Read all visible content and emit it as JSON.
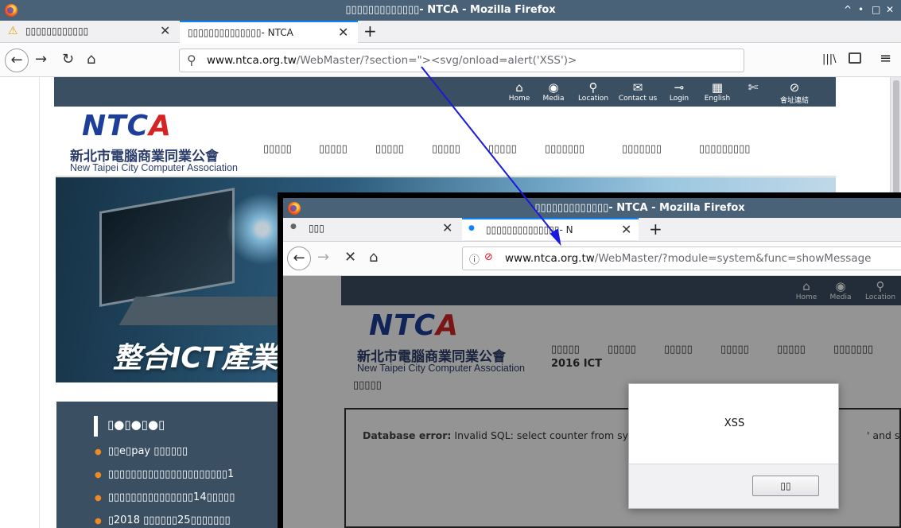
{
  "back_window": {
    "title": "▯▯▯▯▯▯▯▯▯▯▯▯▯- NTCA - Mozilla Firefox",
    "controls": [
      "^",
      "•",
      "□",
      "✕"
    ],
    "tabs": [
      {
        "label": "▯▯▯▯▯▯▯▯▯▯▯▯",
        "icon": "warning-icon",
        "close": "✕"
      },
      {
        "label": "▯▯▯▯▯▯▯▯▯▯▯▯▯▯- NTCA",
        "close": "✕"
      }
    ],
    "new_tab": "+",
    "url_host": "www.ntca.org.tw",
    "url_path": "/WebMaster/?section=\"><svg/onload=alert('XSS')>",
    "toolbar_right": [
      "|||\\",
      "▯",
      "≡"
    ]
  },
  "site": {
    "top_icons": [
      {
        "label": "Home",
        "glyph": "⌂"
      },
      {
        "label": "Media",
        "glyph": "◉"
      },
      {
        "label": "Location",
        "glyph": "⚲"
      },
      {
        "label": "Contact us",
        "glyph": "✉"
      },
      {
        "label": "Login",
        "glyph": "⊸"
      },
      {
        "label": "English",
        "glyph": "▦"
      },
      {
        "label": "",
        "glyph": "✄"
      },
      {
        "label": "會址連結",
        "glyph": "⊘"
      }
    ],
    "logo_text": "NTC",
    "logo_a": "A",
    "name_cn": "新北市電腦商業同業公會",
    "name_en": "New Taipei City Computer Association",
    "menu": [
      "▯▯▯▯▯",
      "▯▯▯▯▯",
      "▯▯▯▯▯",
      "▯▯▯▯▯",
      "▯▯▯▯▯",
      "▯▯▯▯▯▯▯",
      "▯▯▯▯▯▯▯",
      "▯▯▯▯▯▯▯▯▯"
    ],
    "banner_text": "整合ICT產業",
    "news_title": "▯●▯●▯●▯",
    "news": [
      "▯▯e▯pay ▯▯▯▯▯▯",
      "▯▯▯▯▯▯▯▯▯▯▯▯▯▯▯▯▯▯▯▯▯1",
      "▯▯▯▯▯▯▯▯▯▯▯▯▯▯▯14▯▯▯▯▯",
      "▯2018 ▯▯▯▯▯▯25▯▯▯▯▯▯▯"
    ]
  },
  "front_window": {
    "title": "▯▯▯▯▯▯▯▯▯▯▯▯▯- NTCA - Mozilla Firefox",
    "tabs": [
      {
        "label": "▯▯▯",
        "close": "✕"
      },
      {
        "label": "▯▯▯▯▯▯▯▯▯▯▯▯▯▯- N",
        "close": "✕"
      }
    ],
    "new_tab": "+",
    "url_host": "www.ntca.org.tw",
    "url_path": "/WebMaster/?module=system&func=showMessage",
    "site_icons": [
      "Home",
      "Media",
      "Location"
    ],
    "menu": [
      "▯▯▯▯▯",
      "▯▯▯▯▯",
      "▯▯▯▯▯",
      "▯▯▯▯▯",
      "▯▯▯▯▯",
      "▯▯▯▯▯▯▯"
    ],
    "sub_title": "2016 ICT",
    "sub_menu": "▯▯▯▯▯",
    "error_label": "Database error:",
    "error_text": "Invalid SQL: select counter from syst",
    "error_tail": "' and sid=''",
    "dialog_message": "XSS",
    "dialog_ok": "▯▯"
  },
  "colors": {
    "titlebar": "#4a6278",
    "site_dark": "#3b4f62",
    "arrow": "#1a1adc",
    "tab_accent": "#0a84ff"
  }
}
